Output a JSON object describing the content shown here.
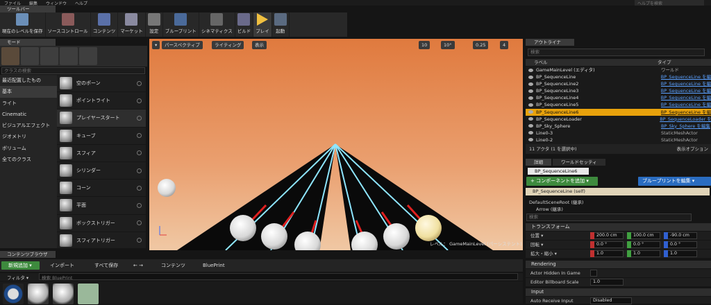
{
  "menu": [
    "ファイル",
    "編集",
    "ウィンドウ",
    "ヘルプ"
  ],
  "help_search_placeholder": "ヘルプを検索",
  "toolbar_tab": "ツールバー",
  "toolbar": [
    "現在のレベルを保存",
    "ソースコントロール",
    "コンテンツ",
    "マーケット",
    "設定",
    "ブループリント",
    "シネマティクス",
    "ビルド",
    "プレイ",
    "起動"
  ],
  "modes": {
    "tab": "モード",
    "search_placeholder": "クラスの検索",
    "categories": [
      "最近配置したもの",
      "基本",
      "ライト",
      "Cinematic",
      "ビジュアルエフェクト",
      "ジオメトリ",
      "ボリューム",
      "全てのクラス"
    ],
    "items": [
      "空のポーン",
      "ポイントライト",
      "プレイヤースタート",
      "キューブ",
      "スフィア",
      "シリンダー",
      "コーン",
      "平面",
      "ボックストリガー",
      "スフィアトリガー"
    ]
  },
  "viewport": {
    "perspective": "パースペクティブ",
    "lit": "ライティング",
    "show": "表示",
    "grid_snap": "10",
    "rot_snap": "10°",
    "scale_snap": "0.25",
    "cam_speed": "4",
    "level_label": "レベル：  GameMainLevel (パーシステント)"
  },
  "outliner": {
    "tab": "アウトライナ",
    "search_placeholder": "検索",
    "col_label": "ラベル",
    "col_type": "タイプ",
    "rows": [
      {
        "name": "GameMainLevel (エディタ)",
        "type": "ワールド"
      },
      {
        "name": "BP_SequenceLine",
        "type": "BP_SequenceLine を編"
      },
      {
        "name": "BP_SequenceLine2",
        "type": "BP_SequenceLine を編"
      },
      {
        "name": "BP_SequenceLine3",
        "type": "BP_SequenceLine を編"
      },
      {
        "name": "BP_SequenceLine4",
        "type": "BP_SequenceLine を編"
      },
      {
        "name": "BP_SequenceLine5",
        "type": "BP_SequenceLine を編"
      },
      {
        "name": "BP_SequenceLine6",
        "type": "BP_SequenceLine を編"
      },
      {
        "name": "BP_SequenceLoader",
        "type": "BP_SequenceLoader を"
      },
      {
        "name": "BP_Sky_Sphere",
        "type": "BP_Sky_Sphere を編集"
      },
      {
        "name": "Line0-3",
        "type": "StaticMeshActor"
      },
      {
        "name": "Line0-2",
        "type": "StaticMeshActor"
      }
    ],
    "footer": "11 アクタ (1 を選択中)",
    "view_options": "表示オプション"
  },
  "details": {
    "tab": "詳細",
    "tab2": "ワールドセッティ",
    "name": "BP_SequenceLine6",
    "add_component": "+ コンポーネントを追加 ▾",
    "bp_edit": "ブループリントを編集 ▾",
    "self": "BP_SequenceLine (self)",
    "root": "DefaultSceneRoot (継承)",
    "arrow": "Arrow (継承)",
    "search_placeholder": "検索",
    "transform": "トランスフォーム",
    "location": {
      "label": "位置 ▾",
      "x": "200.0 cm",
      "y": "100.0 cm",
      "z": "-90.0 cm"
    },
    "rotation": {
      "label": "回転 ▾",
      "x": "0.0 °",
      "y": "0.0 °",
      "z": "0.0 °"
    },
    "scale": {
      "label": "拡大・縮小 ▾",
      "x": "1.0",
      "y": "1.0",
      "z": "1.0"
    },
    "rendering": "Rendering",
    "hidden_label": "Actor Hidden In Game",
    "billboard_label": "Editor Billboard Scale",
    "billboard_value": "1.0",
    "input": "Input",
    "auto_receive_label": "Auto Receive Input",
    "auto_receive_value": "Disabled"
  },
  "content": {
    "tab": "コンテンツブラウザ",
    "new_add": "新規追加 ▾",
    "import": "インポート",
    "save_all": "すべて保存",
    "path_root": "コンテンツ",
    "path_leaf": "BluePrint",
    "filter": "フィルタ ▾",
    "search_placeholder": "検索 BluePrint"
  },
  "colors": {
    "accent": "#e8a20c",
    "green": "#3d8a3d",
    "blue": "#2a6cc0"
  }
}
